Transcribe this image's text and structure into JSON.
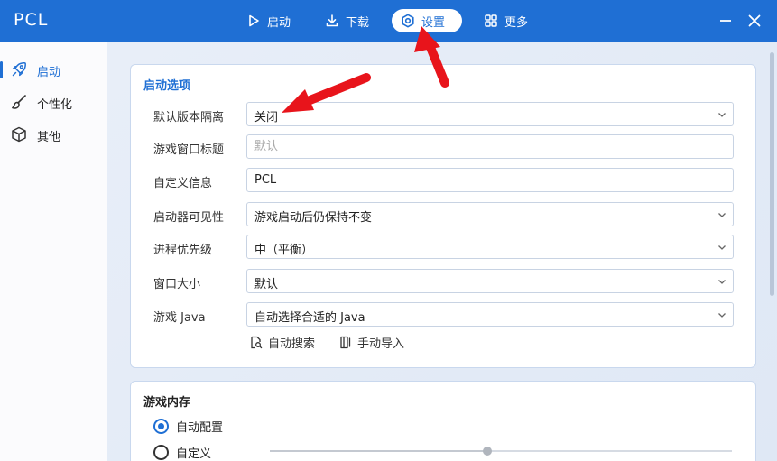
{
  "app": {
    "name": "PCL"
  },
  "nav": [
    {
      "label": "启动",
      "icon": "play-icon"
    },
    {
      "label": "下载",
      "icon": "download-icon"
    },
    {
      "label": "设置",
      "icon": "gear-icon",
      "active": true
    },
    {
      "label": "更多",
      "icon": "grid-icon"
    }
  ],
  "sidebar": {
    "items": [
      {
        "label": "启动",
        "icon": "rocket-icon",
        "active": true
      },
      {
        "label": "个性化",
        "icon": "brush-icon"
      },
      {
        "label": "其他",
        "icon": "box-icon"
      }
    ]
  },
  "launch_options": {
    "title": "启动选项",
    "rows": [
      {
        "label": "默认版本隔离",
        "value": "关闭",
        "kind": "select"
      },
      {
        "label": "游戏窗口标题",
        "placeholder": "默认",
        "value": "",
        "kind": "input"
      },
      {
        "label": "自定义信息",
        "value": "PCL",
        "kind": "input"
      },
      {
        "label": "启动器可见性",
        "value": "游戏启动后仍保持不变",
        "kind": "select"
      },
      {
        "label": "进程优先级",
        "value": "中（平衡）",
        "kind": "select"
      },
      {
        "label": "窗口大小",
        "value": "默认",
        "kind": "select"
      },
      {
        "label": "游戏 Java",
        "value": "自动选择合适的 Java",
        "kind": "select"
      }
    ],
    "auto_search_label": "自动搜索",
    "manual_import_label": "手动导入"
  },
  "memory": {
    "title": "游戏内存",
    "auto_label": "自动配置",
    "custom_label": "自定义",
    "selected": "auto",
    "slider_fraction": 0.47
  },
  "colors": {
    "accent": "#1f6fd4",
    "annotation_arrow": "#e8141b"
  }
}
